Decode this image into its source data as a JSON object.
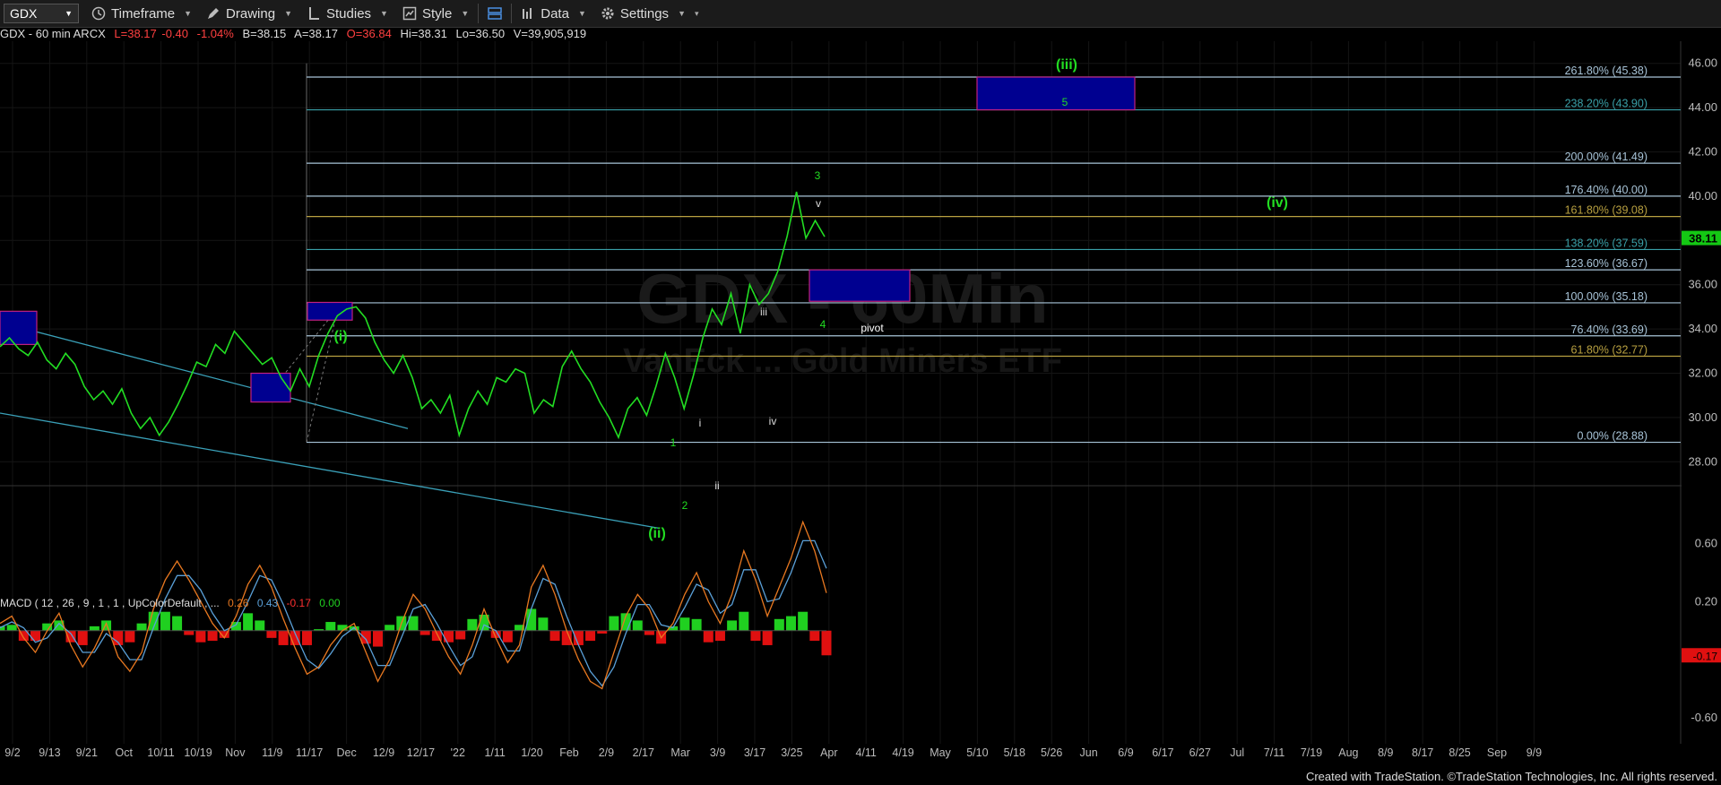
{
  "toolbar": {
    "symbol": "GDX",
    "timeframe": "Timeframe",
    "drawing": "Drawing",
    "studies": "Studies",
    "style": "Style",
    "data": "Data",
    "settings": "Settings"
  },
  "info": {
    "name": "GDX - 60 min ARCX",
    "last": "L=38.17",
    "chg": "-0.40",
    "pct": "-1.04%",
    "bid": "B=38.15",
    "ask": "A=38.17",
    "open": "O=36.84",
    "high": "Hi=38.31",
    "low": "Lo=36.50",
    "vol": "V=39,905,919"
  },
  "watermark": {
    "title": "GDX - 60Min",
    "subtitle": "VanEck ... Gold Miners ETF"
  },
  "macd": {
    "label": "MACD ( 12 , 26 , 9 , 1 , 1 , UpColorDefault , ...",
    "v1": "0.26",
    "v2": "0.43",
    "v3": "-0.17",
    "v4": "0.00"
  },
  "footer": "Created with TradeStation. ©TradeStation Technologies, Inc. All rights reserved.",
  "colors": {
    "bg": "#000000",
    "price": "#22dd22",
    "fib": "#a8c4d8",
    "fib_gold": "#b8a040",
    "fib_teal": "#3aa0a8",
    "box": "#000090",
    "box_edge": "#c02080",
    "macd": "#5aa0d8",
    "signal": "#e87820",
    "hist_up": "#20d020",
    "hist_dn": "#e01010"
  },
  "chart_data": {
    "type": "line",
    "title": "GDX - 60 min ARCX",
    "y_axis": {
      "min": 27.0,
      "max": 47.0,
      "ticks": [
        "28.00",
        "30.00",
        "32.00",
        "34.00",
        "36.00",
        "38.00",
        "40.00",
        "42.00",
        "44.00",
        "46.00"
      ]
    },
    "last_price_label": "38.11",
    "x_ticks": [
      "9/2",
      "9/13",
      "9/21",
      "Oct",
      "10/11",
      "10/19",
      "Nov",
      "11/9",
      "11/17",
      "Dec",
      "12/9",
      "12/17",
      "'22",
      "1/11",
      "1/20",
      "Feb",
      "2/9",
      "2/17",
      "Mar",
      "3/9",
      "3/17",
      "3/25",
      "Apr",
      "4/11",
      "4/19",
      "May",
      "5/10",
      "5/18",
      "5/26",
      "Jun",
      "6/9",
      "6/17",
      "6/27",
      "Jul",
      "7/11",
      "7/19",
      "Aug",
      "8/9",
      "8/17",
      "8/25",
      "Sep",
      "9/9"
    ],
    "series": [
      {
        "values": [
          33.2,
          33.6,
          33.1,
          32.8,
          33.4,
          32.6,
          32.2,
          32.9,
          32.4,
          31.4,
          30.8,
          31.2,
          30.6,
          31.3,
          30.2,
          29.5,
          30.0,
          29.2,
          29.8,
          30.6,
          31.5,
          32.5,
          32.3,
          33.3,
          32.9,
          33.9,
          33.4,
          32.9,
          32.4,
          32.7,
          31.8,
          31.2,
          32.2,
          31.4,
          32.8,
          33.8,
          34.6,
          34.9,
          35.0,
          34.5,
          33.4,
          32.6,
          32.0,
          32.8,
          31.8,
          30.4,
          30.8,
          30.2,
          31.0,
          29.2,
          30.4,
          31.2,
          30.6,
          31.8,
          31.6,
          32.2,
          32.0,
          30.2,
          30.8,
          30.5,
          32.3,
          33.0,
          32.2,
          31.6,
          30.7,
          30.0,
          29.1,
          30.4,
          30.9,
          30.1,
          31.4,
          32.9,
          31.8,
          30.4,
          31.9,
          33.6,
          34.9,
          34.2,
          35.6,
          33.8,
          36.0,
          35.1,
          35.6,
          36.6,
          38.2,
          40.2,
          38.1,
          38.9,
          38.17
        ]
      }
    ],
    "fib_levels": [
      {
        "label": "261.80% (45.38)",
        "value": 45.38,
        "color": "#a8c4d8"
      },
      {
        "label": "238.20% (43.90)",
        "value": 43.9,
        "color": "#3aa0a8"
      },
      {
        "label": "200.00% (41.49)",
        "value": 41.49,
        "color": "#a8c4d8"
      },
      {
        "label": "176.40% (40.00)",
        "value": 40.0,
        "color": "#a8c4d8"
      },
      {
        "label": "161.80% (39.08)",
        "value": 39.08,
        "color": "#b8a040"
      },
      {
        "label": "138.20% (37.59)",
        "value": 37.59,
        "color": "#3aa0a8"
      },
      {
        "label": "123.60% (36.67)",
        "value": 36.67,
        "color": "#a8c4d8"
      },
      {
        "label": "100.00% (35.18)",
        "value": 35.18,
        "color": "#a8c4d8"
      },
      {
        "label": "76.40% (33.69)",
        "value": 33.69,
        "color": "#a8c4d8"
      },
      {
        "label": "61.80% (32.77)",
        "value": 32.77,
        "color": "#b8a040"
      },
      {
        "label": "0.00% (28.88)",
        "value": 28.88,
        "color": "#a8c4d8"
      }
    ],
    "annotations": [
      {
        "text": "(iii)",
        "color": "#22dd22"
      },
      {
        "text": "5",
        "color": "#22dd22"
      },
      {
        "text": "3",
        "color": "#22dd22"
      },
      {
        "text": "v",
        "color": "#dddddd"
      },
      {
        "text": "(iv)",
        "color": "#22dd22"
      },
      {
        "text": "iii",
        "color": "#dddddd"
      },
      {
        "text": "4",
        "color": "#22dd22"
      },
      {
        "text": "pivot",
        "color": "#ffffff"
      },
      {
        "text": "(i)",
        "color": "#22dd22"
      },
      {
        "text": "i",
        "color": "#dddddd"
      },
      {
        "text": "iv",
        "color": "#dddddd"
      },
      {
        "text": "1",
        "color": "#22dd22"
      },
      {
        "text": "ii",
        "color": "#dddddd"
      },
      {
        "text": "2",
        "color": "#22dd22"
      },
      {
        "text": "(ii)",
        "color": "#22dd22"
      }
    ],
    "macd_axis": {
      "ticks": [
        "0.60",
        "0.20",
        "-0.60"
      ],
      "current": "-0.17"
    },
    "macd": {
      "macd": [
        0.05,
        0.1,
        -0.05,
        -0.15,
        0.0,
        0.12,
        -0.1,
        -0.25,
        -0.12,
        0.05,
        -0.18,
        -0.28,
        -0.15,
        0.15,
        0.35,
        0.48,
        0.35,
        0.2,
        0.05,
        -0.05,
        0.1,
        0.32,
        0.45,
        0.3,
        0.08,
        -0.12,
        -0.3,
        -0.25,
        -0.1,
        0.0,
        0.05,
        -0.15,
        -0.35,
        -0.2,
        0.05,
        0.25,
        0.15,
        -0.02,
        -0.18,
        -0.3,
        -0.1,
        0.15,
        -0.05,
        -0.22,
        -0.1,
        0.3,
        0.45,
        0.25,
        0.0,
        -0.2,
        -0.35,
        -0.4,
        -0.15,
        0.1,
        0.25,
        0.15,
        -0.05,
        0.05,
        0.25,
        0.4,
        0.2,
        0.05,
        0.25,
        0.55,
        0.35,
        0.1,
        0.3,
        0.5,
        0.75,
        0.55,
        0.26
      ],
      "signal": [
        0.02,
        0.06,
        0.02,
        -0.08,
        -0.05,
        0.05,
        -0.02,
        -0.15,
        -0.15,
        -0.02,
        -0.08,
        -0.2,
        -0.2,
        0.02,
        0.22,
        0.38,
        0.38,
        0.28,
        0.12,
        0.0,
        0.04,
        0.2,
        0.38,
        0.35,
        0.18,
        -0.02,
        -0.2,
        -0.26,
        -0.16,
        -0.04,
        0.02,
        -0.06,
        -0.24,
        -0.24,
        -0.05,
        0.15,
        0.18,
        0.05,
        -0.1,
        -0.24,
        -0.18,
        0.04,
        0.0,
        -0.14,
        -0.14,
        0.15,
        0.36,
        0.32,
        0.1,
        -0.1,
        -0.28,
        -0.38,
        -0.25,
        -0.02,
        0.18,
        0.18,
        0.04,
        0.02,
        0.16,
        0.32,
        0.28,
        0.12,
        0.18,
        0.42,
        0.42,
        0.2,
        0.22,
        0.4,
        0.62,
        0.62,
        0.43
      ],
      "histogram": [
        0.03,
        0.04,
        -0.07,
        -0.07,
        0.05,
        0.07,
        -0.08,
        -0.1,
        0.03,
        0.07,
        -0.1,
        -0.08,
        0.05,
        0.13,
        0.13,
        0.1,
        -0.03,
        -0.08,
        -0.07,
        -0.05,
        0.06,
        0.12,
        0.07,
        -0.05,
        -0.1,
        -0.1,
        -0.1,
        0.01,
        0.06,
        0.04,
        0.03,
        -0.09,
        -0.11,
        0.04,
        0.1,
        0.1,
        -0.03,
        -0.07,
        -0.08,
        -0.06,
        0.08,
        0.11,
        -0.05,
        -0.08,
        0.04,
        0.15,
        0.09,
        -0.07,
        -0.1,
        -0.1,
        -0.07,
        -0.02,
        0.1,
        0.12,
        0.07,
        -0.03,
        -0.09,
        0.03,
        0.09,
        0.08,
        -0.08,
        -0.07,
        0.07,
        0.13,
        -0.07,
        -0.1,
        0.08,
        0.1,
        0.13,
        -0.07,
        -0.17
      ]
    }
  }
}
